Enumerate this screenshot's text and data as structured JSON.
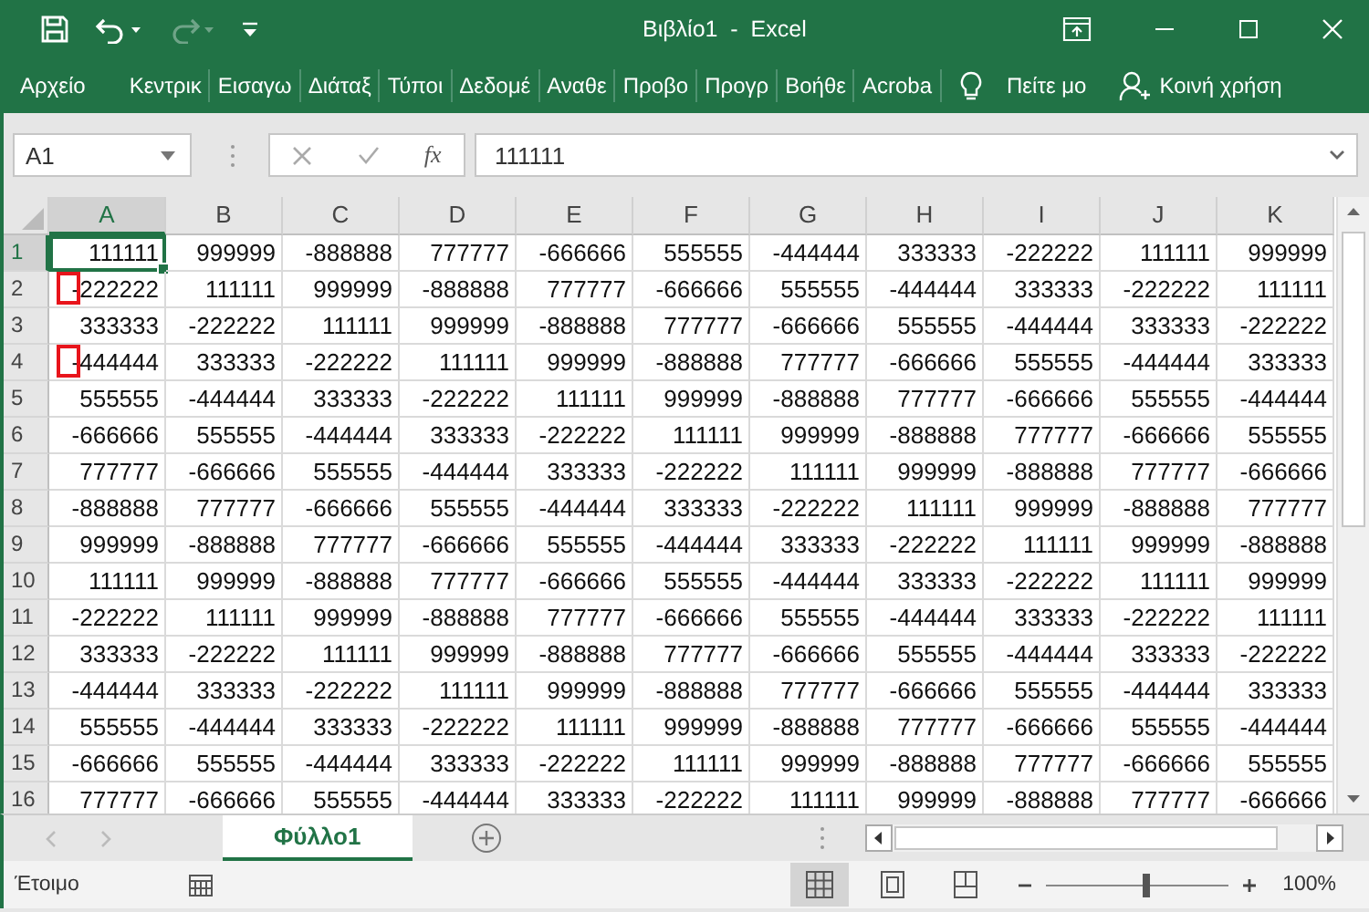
{
  "window": {
    "title": "Βιβλίο1  -  Excel"
  },
  "quick_access": [
    {
      "kind": "save",
      "disabled": false
    },
    {
      "kind": "undo",
      "disabled": false
    },
    {
      "kind": "redo",
      "disabled": true
    },
    {
      "kind": "customize",
      "disabled": false
    }
  ],
  "ribbon_tabs": [
    "Αρχείο",
    "Κεντρικ",
    "Εισαγω",
    "Διάταξ",
    "Τύποι",
    "Δεδομέ",
    "Αναθε",
    "Προβο",
    "Προγρ",
    "Βοήθε",
    "Acroba"
  ],
  "tell_me": "Πείτε μο",
  "share": "Κοινή χρήση",
  "name_box": "A1",
  "fx": "fx",
  "formula": "111111",
  "columns": [
    {
      "label": "A",
      "selected": true
    },
    {
      "label": "B",
      "selected": false
    },
    {
      "label": "C",
      "selected": false
    },
    {
      "label": "D",
      "selected": false
    },
    {
      "label": "E",
      "selected": false
    },
    {
      "label": "F",
      "selected": false
    },
    {
      "label": "G",
      "selected": false
    },
    {
      "label": "H",
      "selected": false
    },
    {
      "label": "I",
      "selected": false
    },
    {
      "label": "J",
      "selected": false
    },
    {
      "label": "K",
      "selected": false
    }
  ],
  "rows": [
    {
      "header": "1",
      "selected": true,
      "marked": false,
      "cells": [
        "111111",
        "999999",
        "-888888",
        "777777",
        "-666666",
        "555555",
        "-444444",
        "333333",
        "-222222",
        "111111",
        "999999"
      ]
    },
    {
      "header": "2",
      "selected": false,
      "marked": true,
      "cells": [
        "-222222",
        "111111",
        "999999",
        "-888888",
        "777777",
        "-666666",
        "555555",
        "-444444",
        "333333",
        "-222222",
        "111111"
      ]
    },
    {
      "header": "3",
      "selected": false,
      "marked": false,
      "cells": [
        "333333",
        "-222222",
        "111111",
        "999999",
        "-888888",
        "777777",
        "-666666",
        "555555",
        "-444444",
        "333333",
        "-222222"
      ]
    },
    {
      "header": "4",
      "selected": false,
      "marked": true,
      "cells": [
        "-444444",
        "333333",
        "-222222",
        "111111",
        "999999",
        "-888888",
        "777777",
        "-666666",
        "555555",
        "-444444",
        "333333"
      ]
    },
    {
      "header": "5",
      "selected": false,
      "marked": false,
      "cells": [
        "555555",
        "-444444",
        "333333",
        "-222222",
        "111111",
        "999999",
        "-888888",
        "777777",
        "-666666",
        "555555",
        "-444444"
      ]
    },
    {
      "header": "6",
      "selected": false,
      "marked": false,
      "cells": [
        "-666666",
        "555555",
        "-444444",
        "333333",
        "-222222",
        "111111",
        "999999",
        "-888888",
        "777777",
        "-666666",
        "555555"
      ]
    },
    {
      "header": "7",
      "selected": false,
      "marked": false,
      "cells": [
        "777777",
        "-666666",
        "555555",
        "-444444",
        "333333",
        "-222222",
        "111111",
        "999999",
        "-888888",
        "777777",
        "-666666"
      ]
    },
    {
      "header": "8",
      "selected": false,
      "marked": false,
      "cells": [
        "-888888",
        "777777",
        "-666666",
        "555555",
        "-444444",
        "333333",
        "-222222",
        "111111",
        "999999",
        "-888888",
        "777777"
      ]
    },
    {
      "header": "9",
      "selected": false,
      "marked": false,
      "cells": [
        "999999",
        "-888888",
        "777777",
        "-666666",
        "555555",
        "-444444",
        "333333",
        "-222222",
        "111111",
        "999999",
        "-888888"
      ]
    },
    {
      "header": "10",
      "selected": false,
      "marked": false,
      "cells": [
        "111111",
        "999999",
        "-888888",
        "777777",
        "-666666",
        "555555",
        "-444444",
        "333333",
        "-222222",
        "111111",
        "999999"
      ]
    },
    {
      "header": "11",
      "selected": false,
      "marked": false,
      "cells": [
        "-222222",
        "111111",
        "999999",
        "-888888",
        "777777",
        "-666666",
        "555555",
        "-444444",
        "333333",
        "-222222",
        "111111"
      ]
    },
    {
      "header": "12",
      "selected": false,
      "marked": false,
      "cells": [
        "333333",
        "-222222",
        "111111",
        "999999",
        "-888888",
        "777777",
        "-666666",
        "555555",
        "-444444",
        "333333",
        "-222222"
      ]
    },
    {
      "header": "13",
      "selected": false,
      "marked": false,
      "cells": [
        "-444444",
        "333333",
        "-222222",
        "111111",
        "999999",
        "-888888",
        "777777",
        "-666666",
        "555555",
        "-444444",
        "333333"
      ]
    },
    {
      "header": "14",
      "selected": false,
      "marked": false,
      "cells": [
        "555555",
        "-444444",
        "333333",
        "-222222",
        "111111",
        "999999",
        "-888888",
        "777777",
        "-666666",
        "555555",
        "-444444"
      ]
    },
    {
      "header": "15",
      "selected": false,
      "marked": false,
      "cells": [
        "-666666",
        "555555",
        "-444444",
        "333333",
        "-222222",
        "111111",
        "999999",
        "-888888",
        "777777",
        "-666666",
        "555555"
      ]
    },
    {
      "header": "16",
      "selected": false,
      "marked": false,
      "cells": [
        "777777",
        "-666666",
        "555555",
        "-444444",
        "333333",
        "-222222",
        "111111",
        "999999",
        "-888888",
        "777777",
        "-666666"
      ]
    }
  ],
  "sheet_tabs": [
    {
      "label": "Φύλλο1",
      "selected": true
    }
  ],
  "status_bar": {
    "text": "Έτοιμο",
    "views": [
      {
        "kind": "normal",
        "selected": true
      },
      {
        "kind": "page_layout",
        "selected": false
      },
      {
        "kind": "page_break",
        "selected": false
      }
    ],
    "zoom": {
      "level": 0.55,
      "reading": "100%"
    }
  }
}
